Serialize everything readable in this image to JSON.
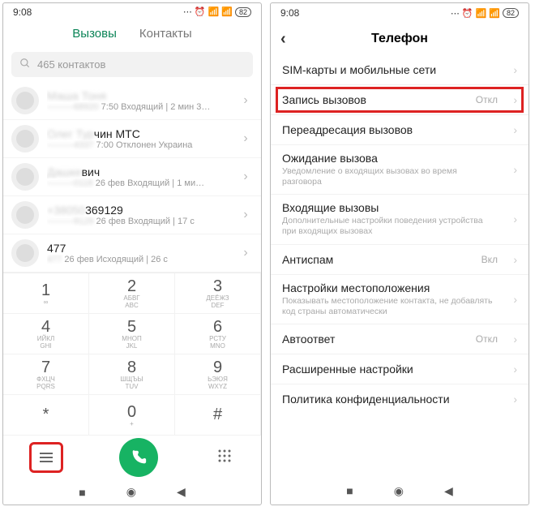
{
  "status": {
    "time": "9:08",
    "battery": "82"
  },
  "tabs": {
    "calls": "Вызовы",
    "contacts": "Контакты"
  },
  "search": {
    "placeholder": "465 контактов"
  },
  "calls": [
    {
      "title_blur": "Маша Тоня",
      "sub_blur": "———68920",
      "sub_rest": " 7:50 Входящий | 2 мин 3…"
    },
    {
      "title_blur": "Олег Тур",
      "title_rest": "чин МТС",
      "sub_blur": "———4337",
      "sub_rest": " 7:00 Отклонен Украина"
    },
    {
      "title_blur": "Дашке",
      "title_rest": "вич",
      "sub_blur": "———0118",
      "sub_rest": " 26 фев Входящий | 1 ми…"
    },
    {
      "title_blur": "+38050",
      "title_rest": "369129",
      "sub_blur": "———9129",
      "sub_rest": " 26 фев Входящий | 17 с"
    },
    {
      "title_rest": "477",
      "sub_blur": "477",
      "sub_rest": " 26 фев Исходящий | 26 с"
    }
  ],
  "keys": [
    {
      "n": "1",
      "l": "∞"
    },
    {
      "n": "2",
      "l": "АБВГ\nABC"
    },
    {
      "n": "3",
      "l": "ДЕЁЖЗ\nDEF"
    },
    {
      "n": "4",
      "l": "ИЙКЛ\nGHI"
    },
    {
      "n": "5",
      "l": "МНОП\nJKL"
    },
    {
      "n": "6",
      "l": "РСТУ\nMNO"
    },
    {
      "n": "7",
      "l": "ФХЦЧ\nPQRS"
    },
    {
      "n": "8",
      "l": "ШЩЪЫ\nTUV"
    },
    {
      "n": "9",
      "l": "ЬЭЮЯ\nWXYZ"
    },
    {
      "n": "*",
      "l": ""
    },
    {
      "n": "0",
      "l": "+"
    },
    {
      "n": "#",
      "l": ""
    }
  ],
  "settings": {
    "title": "Телефон",
    "rows": {
      "sim": {
        "title": "SIM-карты и мобильные сети"
      },
      "record": {
        "title": "Запись вызовов",
        "value": "Откл"
      },
      "forward": {
        "title": "Переадресация вызовов"
      },
      "waiting": {
        "title": "Ожидание вызова",
        "sub": "Уведомление о входящих вызовах во время разговора"
      },
      "incoming": {
        "title": "Входящие вызовы",
        "sub": "Дополнительные настройки поведения устройства при входящих вызовах"
      },
      "antispam": {
        "title": "Антиспам",
        "value": "Вкл"
      },
      "location": {
        "title": "Настройки местоположения",
        "sub": "Показывать местоположение контакта, не добавлять код страны автоматически"
      },
      "auto": {
        "title": "Автоответ",
        "value": "Откл"
      },
      "advanced": {
        "title": "Расширенные настройки"
      },
      "privacy": {
        "title": "Политика конфиденциальности"
      }
    }
  }
}
